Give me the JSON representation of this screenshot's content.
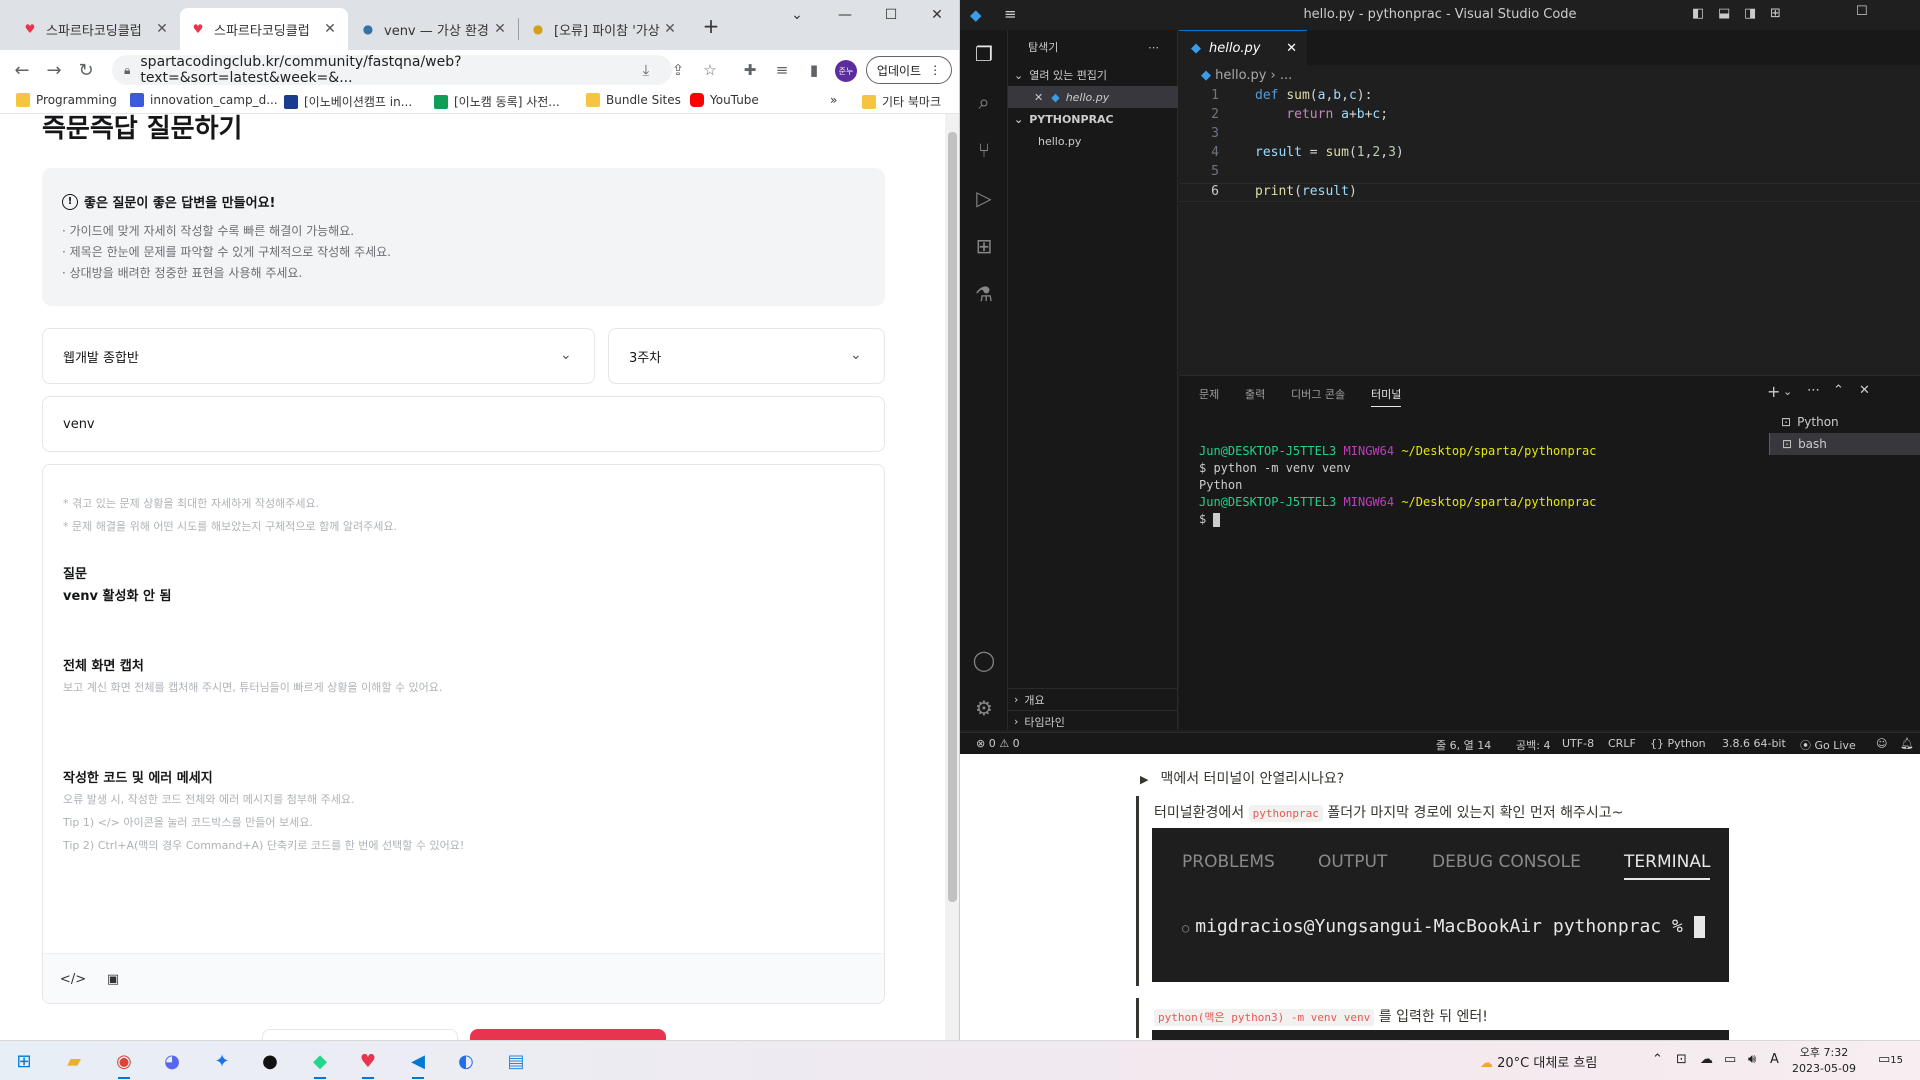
{
  "chrome": {
    "tabs": [
      {
        "title": "스파르타코딩클럽",
        "active": false
      },
      {
        "title": "스파르타코딩클럽",
        "active": true
      },
      {
        "title": "venv — 가상 환경",
        "active": false
      },
      {
        "title": "[오류] 파이참 '가상",
        "active": false
      }
    ],
    "url": "spartacodingclub.kr/community/fastqna/web?text=&sort=latest&week=&...",
    "update_label": "업데이트",
    "profile_label": "준누",
    "bookmarks": [
      {
        "label": "Programming",
        "icon": "folder-icon"
      },
      {
        "label": "innovation_camp_d...",
        "icon": "notion-icon"
      },
      {
        "label": "[이노베이션캠프 in...",
        "icon": "campus-icon"
      },
      {
        "label": "[이노캠 동록] 사전...",
        "icon": "sheets-icon"
      },
      {
        "label": "Bundle Sites",
        "icon": "folder-icon"
      },
      {
        "label": "YouTube",
        "icon": "youtube-icon"
      }
    ],
    "bookmarks_more": "»",
    "other_bookmarks": "기타 북마크"
  },
  "page": {
    "title": "즉문즉답 질문하기",
    "guide": {
      "heading": "좋은 질문이 좋은 답변을 만들어요!",
      "lines": [
        "· 가이드에 맞게 자세히 작성할 수록 빠른 해결이 가능해요.",
        "· 제목은 한눈에 문제를 파악할 수 있게 구체적으로 작성해 주세요.",
        "· 상대방을 배려한 정중한 표현을 사용해 주세요."
      ]
    },
    "course_select": "웹개발 종합반",
    "week_select": "3주차",
    "title_value": "venv",
    "editor": {
      "hint1": "* 겪고 있는 문제 상황을 최대한 자세하게 작성해주세요.",
      "hint2": "* 문제 해결을 위해 어떤 시도를 해보았는지 구체적으로 함께 알려주세요.",
      "question_head": "질문",
      "question_body": "venv 활성화 안 됨",
      "capture_head": "전체 화면 캡처",
      "capture_hint": "보고 계신 화면 전체를 캡처해 주시면, 튜터님들이 빠르게 상황을 이해할 수 있어요.",
      "code_head": "작성한 코드 및 에러 메세지",
      "code_hint1": "오류 발생 시, 작성한 코드 전체와 에러 메시지를 첨부해 주세요.",
      "code_hint2": "Tip 1) </> 아이콘을 눌러 코드박스를 만들어 보세요.",
      "code_hint3": "Tip 2) Ctrl+A(맥의 경우 Command+A) 단축키로 코드를 한 번에 선택할 수 있어요!"
    }
  },
  "vscode": {
    "title": "hello.py - pythonprac - Visual Studio Code",
    "explorer_label": "탐색기",
    "open_editors_label": "열려 있는 편집기",
    "open_file": "hello.py",
    "folder_label": "PYTHONPRAC",
    "folder_file": "hello.py",
    "outline_label": "개요",
    "timeline_label": "타임라인",
    "tab_label": "hello.py",
    "breadcrumb_file": "hello.py",
    "breadcrumb_more": "...",
    "line_numbers": [
      "1",
      "2",
      "3",
      "4",
      "5",
      "6"
    ],
    "panel_tabs": [
      "문제",
      "출력",
      "디버그 콘솔",
      "터미널"
    ],
    "terminal": {
      "user": "Jun@DESKTOP-J5TTEL3",
      "shell": "MINGW64",
      "path": "~/Desktop/sparta/pythonprac",
      "cmd": "$ python -m venv venv",
      "output": "Python",
      "prompt": "$ "
    },
    "terminal_list": [
      "Python",
      "bash"
    ],
    "status": {
      "problems": "⊗ 0 ⚠ 0",
      "position": "줄 6, 열 14",
      "spaces": "공백: 4",
      "encoding": "UTF-8",
      "eol": "CRLF",
      "lang": "Python",
      "version": "3.8.6 64-bit",
      "golive": "Go Live"
    }
  },
  "doc": {
    "summary": "맥에서 터미널이 안열리시나요?",
    "text_pre": "터미널환경에서",
    "inline_code": "pythonprac",
    "text_post": "폴더가 마지막 경로에 있는지 확인 먼저 해주시고~",
    "term_tabs": [
      "PROBLEMS",
      "OUTPUT",
      "DEBUG CONSOLE",
      "TERMINAL"
    ],
    "term_prompt": "migdracios@Yungsangui-MacBookAir pythonprac %",
    "inline_code2": "python(맥은 python3) -m venv venv",
    "text2_post": "를 입력한 뒤 엔터!"
  },
  "taskbar": {
    "weather_temp": "20°C",
    "weather_text": "대체로 흐림",
    "ime": "A",
    "time": "오후 7:32",
    "date": "2023-05-09",
    "notifications": "15"
  }
}
